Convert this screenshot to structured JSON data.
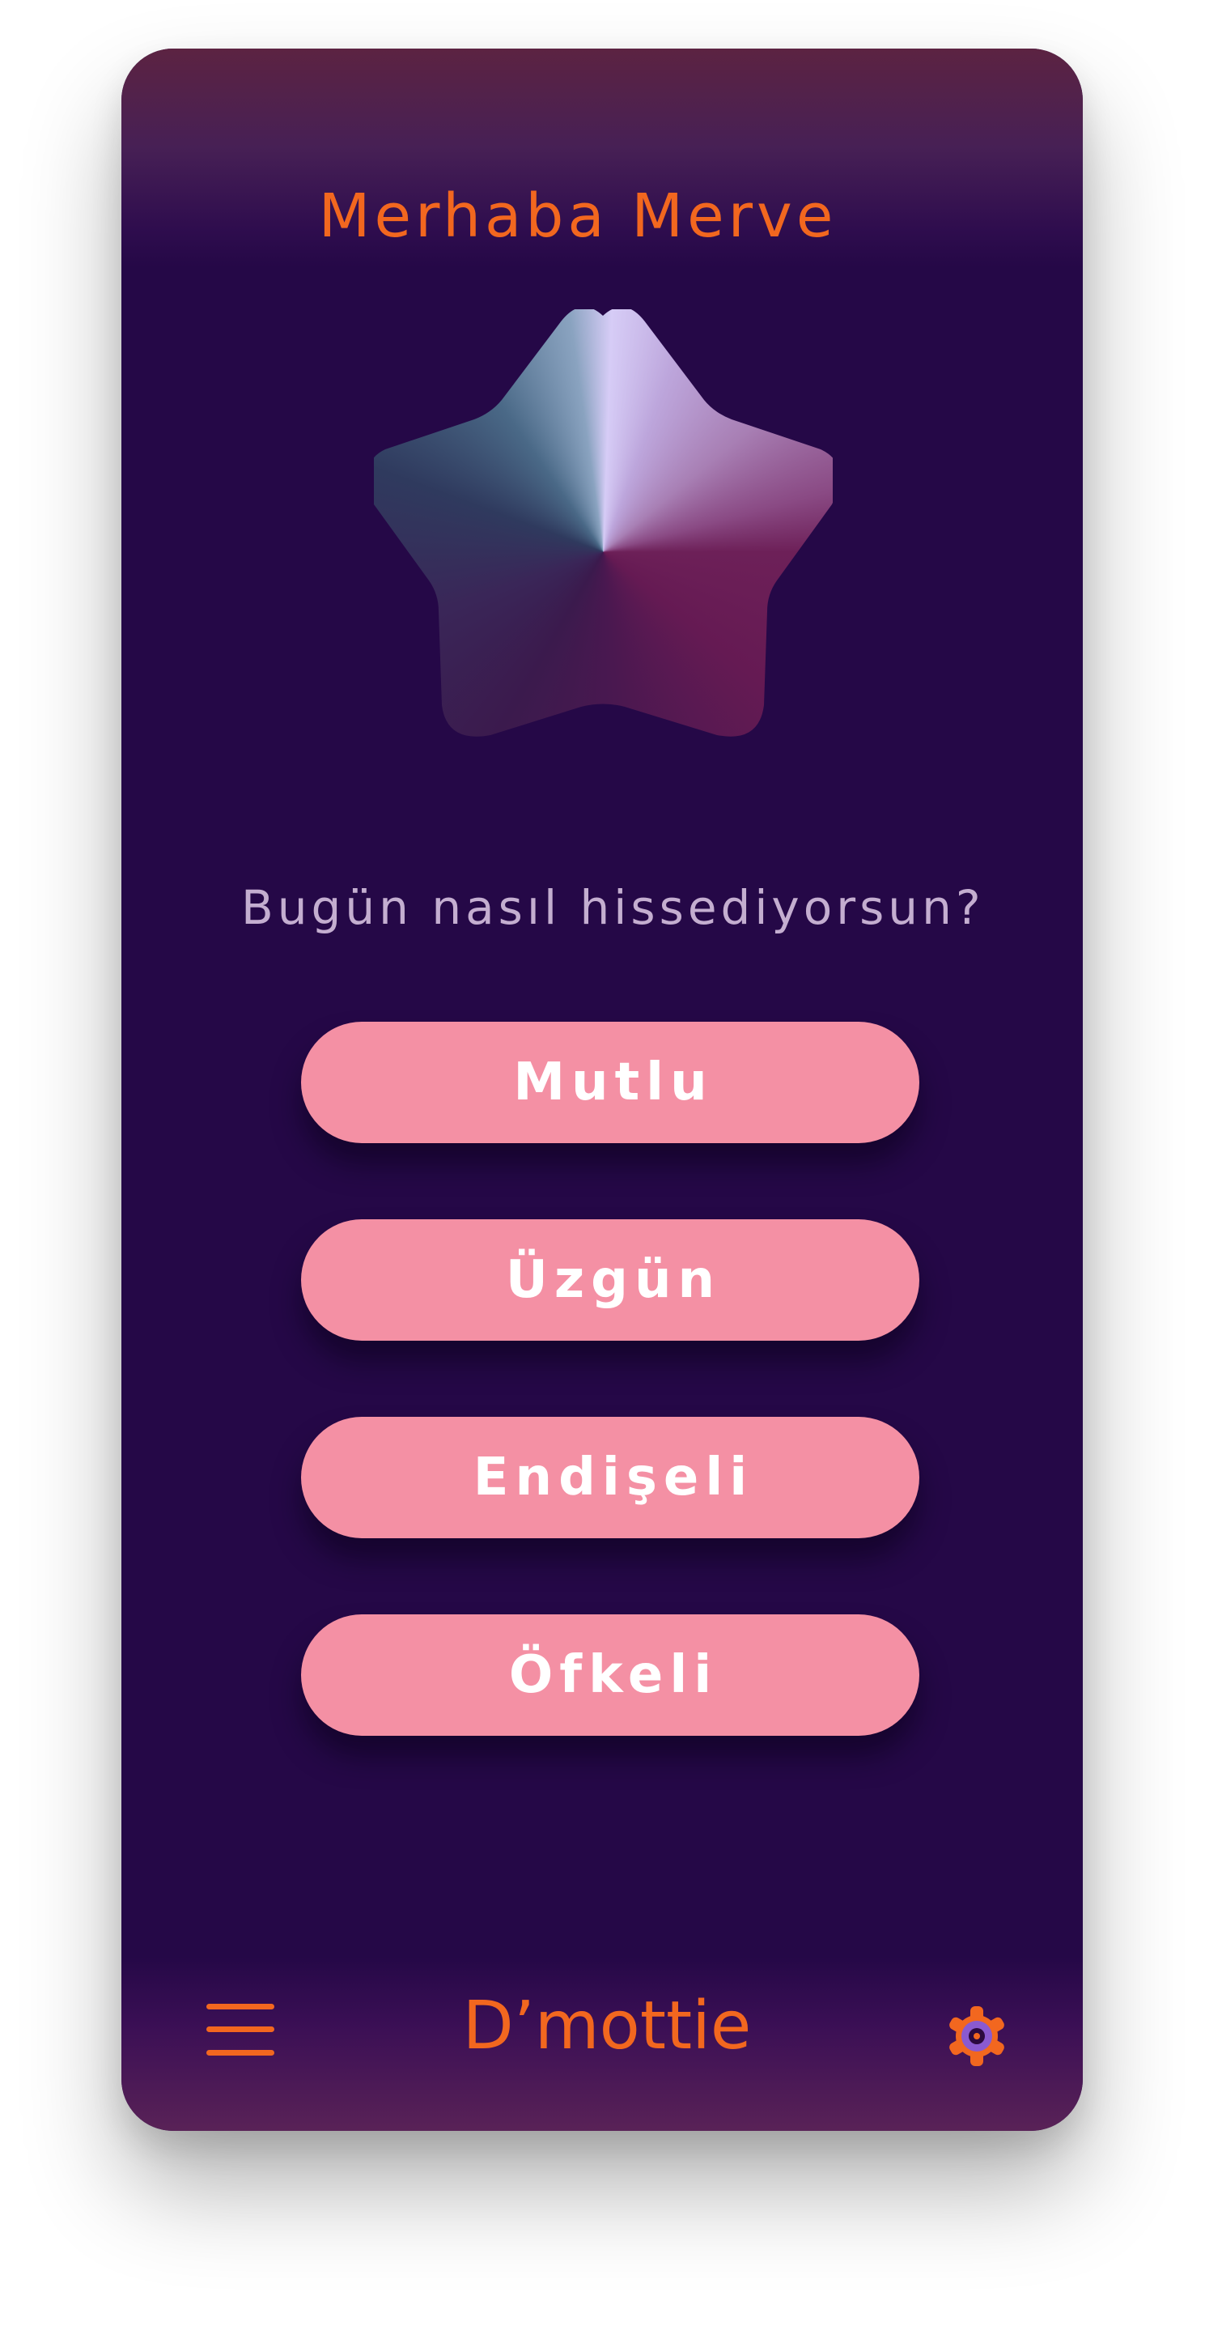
{
  "header": {
    "greeting": "Merhaba Merve"
  },
  "prompt": {
    "question": "Bugün nasıl hissediyorsun?"
  },
  "moods": [
    {
      "label": "Mutlu"
    },
    {
      "label": "Üzgün"
    },
    {
      "label": "Endişeli"
    },
    {
      "label": "Öfkeli"
    }
  ],
  "footer": {
    "brand": "D’mottie",
    "menu_icon": "hamburger-menu-icon",
    "settings_icon": "gear-icon"
  },
  "colors": {
    "background": "#250847",
    "accent_orange": "#f2671f",
    "button_pink": "#f490a4",
    "question_text": "#c4aed0",
    "button_text": "#ffffff"
  }
}
